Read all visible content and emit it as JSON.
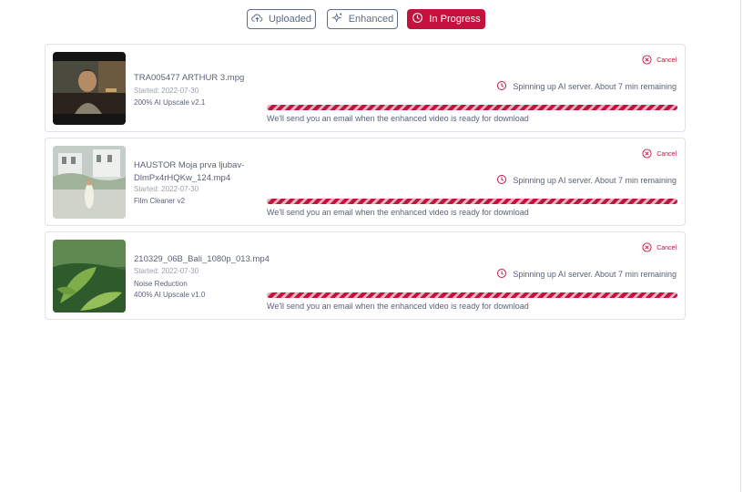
{
  "tabs": [
    {
      "label": "Uploaded",
      "icon": "cloud-upload-icon",
      "active": false
    },
    {
      "label": "Enhanced",
      "icon": "sparkle-icon",
      "active": false
    },
    {
      "label": "In Progress",
      "icon": "clock-icon",
      "active": true
    }
  ],
  "colors": {
    "accent": "#c4123f",
    "tab_outline": "#5d6b86",
    "text": "#5a6275",
    "muted": "#9aa1ae"
  },
  "jobs": [
    {
      "filename": "TRA005477 ARTHUR 3.mpg",
      "started": "Started: 2022-07-30",
      "models": [
        "200% AI Upscale v2.1"
      ],
      "cancel_label": "Cancel",
      "status": "Spinning up AI server. About 7 min remaining",
      "email_note": "We'll send you an email when the enhanced video is ready for download"
    },
    {
      "filename": "HAUSTOR Moja prva ljubav-DlmPx4rHQKw_124.mp4",
      "started": "Started: 2022-07-30",
      "models": [
        "Film Cleaner v2"
      ],
      "cancel_label": "Cancel",
      "status": "Spinning up AI server. About 7 min remaining",
      "email_note": "We'll send you an email when the enhanced video is ready for download"
    },
    {
      "filename": "210329_06B_Bali_1080p_013.mp4",
      "started": "Started: 2022-07-30",
      "models": [
        "Noise Reduction",
        "400% AI Upscale v1.0"
      ],
      "cancel_label": "Cancel",
      "status": "Spinning up AI server. About 7 min remaining",
      "email_note": "We'll send you an email when the enhanced video is ready for download"
    }
  ]
}
